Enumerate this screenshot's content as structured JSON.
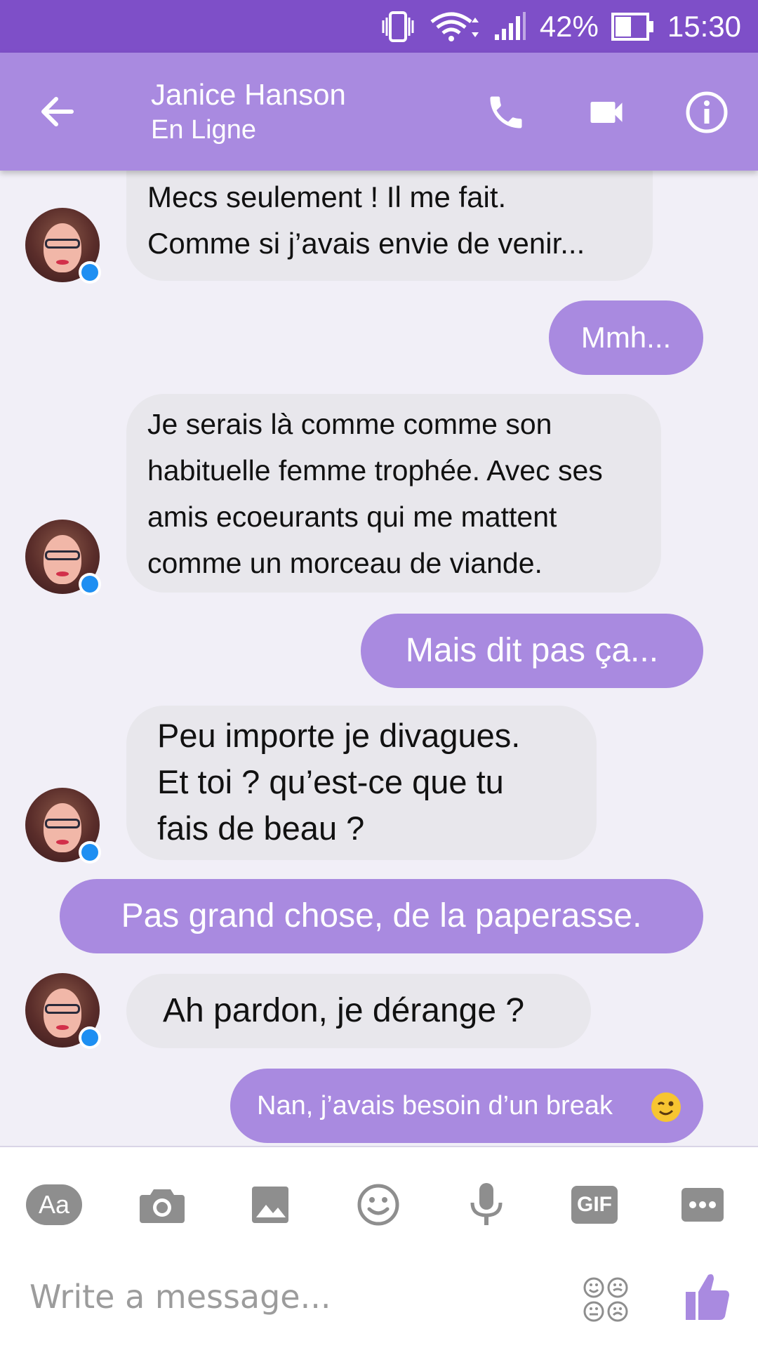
{
  "status_bar": {
    "battery": "42%",
    "time": "15:30"
  },
  "header": {
    "name": "Janice Hanson",
    "status": "En Ligne"
  },
  "messages": [
    {
      "sender": "contact",
      "lines": [
        "Mecs seulement ! Il me fait.",
        "Comme si j’avais envie de venir..."
      ]
    },
    {
      "sender": "me",
      "text": "Mmh..."
    },
    {
      "sender": "contact",
      "lines": [
        "Je serais là comme comme son",
        "habituelle femme trophée. Avec ses",
        "amis ecoeurants qui me mattent",
        "comme un morceau de viande."
      ]
    },
    {
      "sender": "me",
      "text": "Mais dit pas ça..."
    },
    {
      "sender": "contact",
      "lines": [
        "Peu importe je divagues.",
        "Et toi ? qu’est-ce que tu",
        "fais de beau ?"
      ]
    },
    {
      "sender": "me",
      "text": "Pas grand chose, de la paperasse."
    },
    {
      "sender": "contact",
      "lines": [
        "Ah pardon, je dérange ?"
      ]
    },
    {
      "sender": "me",
      "text": "Nan, j’avais besoin d’un break",
      "emoji": "winking-face"
    }
  ],
  "composer": {
    "aa_label": "Aa",
    "gif_label": "GIF",
    "placeholder": "Write a message..."
  },
  "colors": {
    "status_bar": "#7e4fc8",
    "header": "#a98ae0",
    "outgoing": "#a98ae0",
    "incoming": "#e8e7ec"
  }
}
